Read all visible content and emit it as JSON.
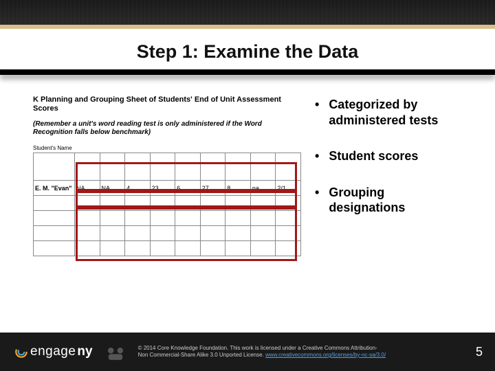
{
  "title": "Step 1: Examine the Data",
  "sheet": {
    "heading": "K Planning and Grouping Sheet of Students' End of Unit Assessment Scores",
    "note": "(Remember a unit's word reading test is only administered if the Word Recognition falls below benchmark)",
    "students_label": "Student's Name"
  },
  "data_row": {
    "name": "E. M. \"Evan\"",
    "cells": [
      "NA",
      "NA",
      "4",
      "23",
      "6",
      "27",
      "8",
      "na",
      "2/1"
    ]
  },
  "bullets": [
    "Categorized by administered tests",
    "Student scores",
    "Grouping designations"
  ],
  "footer": {
    "brand_a": "engage",
    "brand_b": "ny",
    "cc_line1": "© 2014 Core Knowledge Foundation. This work is licensed under a Creative Commons Attribution-",
    "cc_line2": "Non Commercial-Share Alike 3.0 Unported License. ",
    "cc_link": "www.creativecommons.org/licenses/by-nc-sa/3.0/",
    "page": "5"
  }
}
